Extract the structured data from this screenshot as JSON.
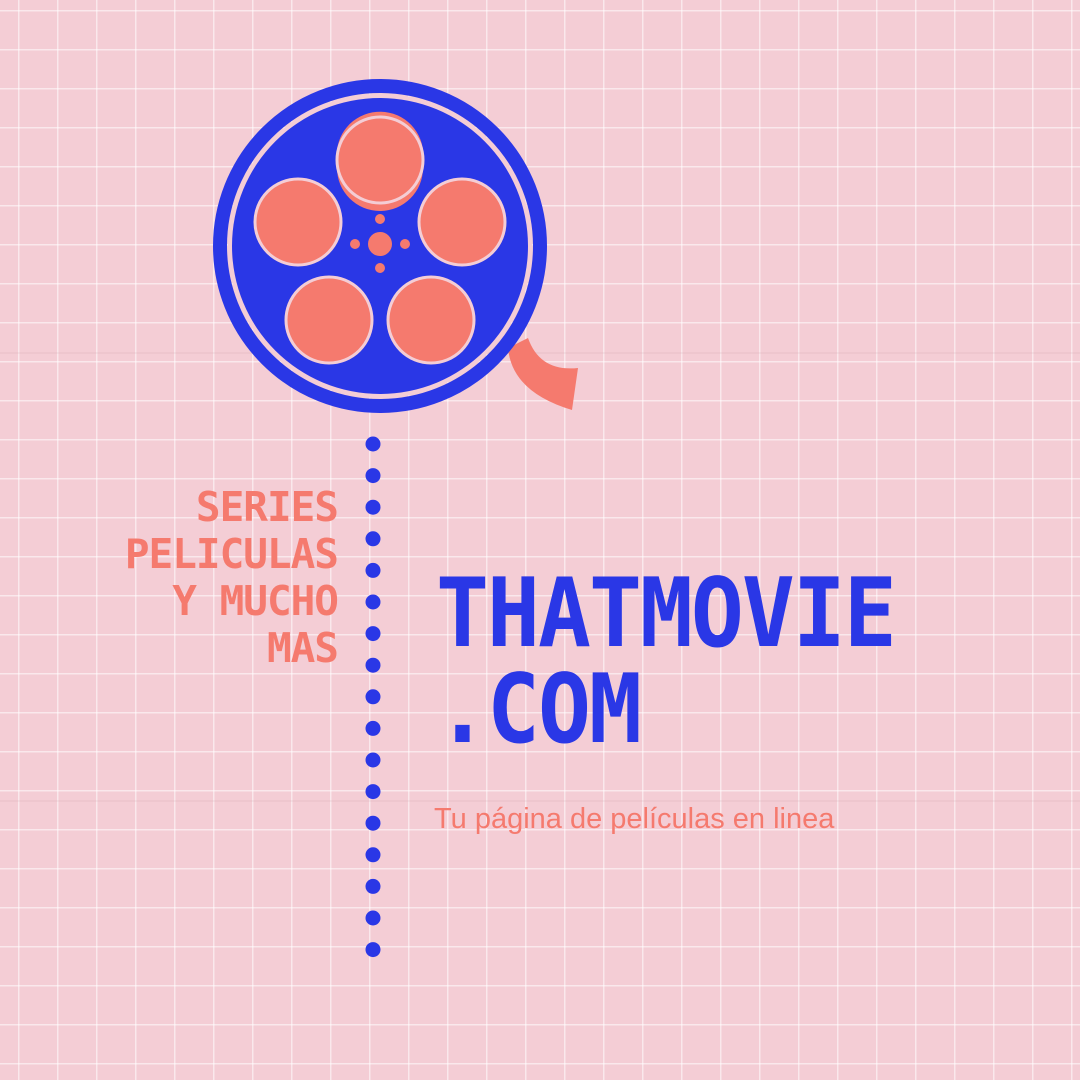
{
  "brand": {
    "tagline_lines": [
      "SERIES",
      "PELICULAS",
      "Y MUCHO",
      "MAS"
    ],
    "site_name_lines": [
      "THATMOVIE",
      ".COM"
    ],
    "subtitle": "Tu página de películas en linea"
  },
  "colors": {
    "background": "#f4cdd5",
    "blue": "#2a37e6",
    "coral": "#f57a6e"
  },
  "icons": [
    "film-reel-icon",
    "dotted-line"
  ]
}
